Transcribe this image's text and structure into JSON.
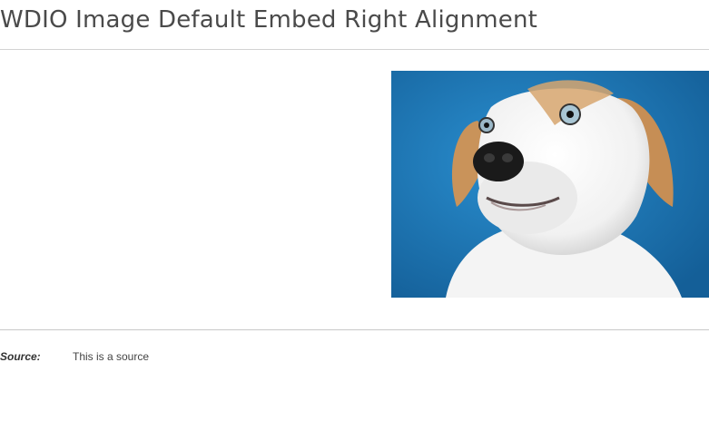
{
  "page": {
    "title": "WDIO Image Default Embed Right Alignment"
  },
  "image": {
    "subject": "dog",
    "background_color": "#1b78b9"
  },
  "source": {
    "label": "Source:",
    "value": "This is a source"
  }
}
